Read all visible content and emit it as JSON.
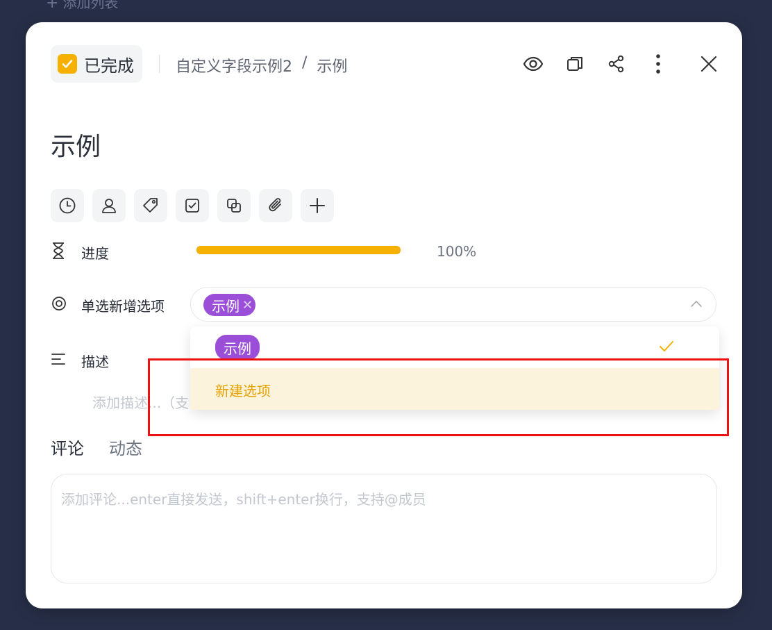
{
  "background": {
    "add_list_label": "添加列表"
  },
  "header": {
    "status_label": "已完成",
    "breadcrumb": {
      "project": "自定义字段示例2",
      "separator": "/",
      "task": "示例"
    },
    "icons": [
      "eye-icon",
      "copy-icon",
      "share-icon",
      "more-icon",
      "close-icon"
    ]
  },
  "title": "示例",
  "toolbar": {
    "icons": [
      "clock-icon",
      "user-icon",
      "tag-icon",
      "checkbox-icon",
      "subtask-icon",
      "attachment-icon",
      "plus-icon"
    ]
  },
  "progress": {
    "label": "进度",
    "value": 100,
    "value_text": "100%"
  },
  "single_select": {
    "label": "单选新增选项",
    "selected_chip": "示例",
    "options": [
      {
        "label": "示例",
        "selected": true
      }
    ],
    "create_option_label": "新建选项"
  },
  "description": {
    "label": "描述",
    "placeholder": "添加描述...（支"
  },
  "tabs": [
    {
      "label": "评论",
      "active": true
    },
    {
      "label": "动态",
      "active": false
    }
  ],
  "comment": {
    "placeholder": "添加评论...enter直接发送，shift+enter换行，支持@成员"
  },
  "colors": {
    "accent": "#f5b000",
    "chip": "#9b4fd8",
    "highlight_border": "#ee1111",
    "option_hover": "#fcf3dc"
  }
}
